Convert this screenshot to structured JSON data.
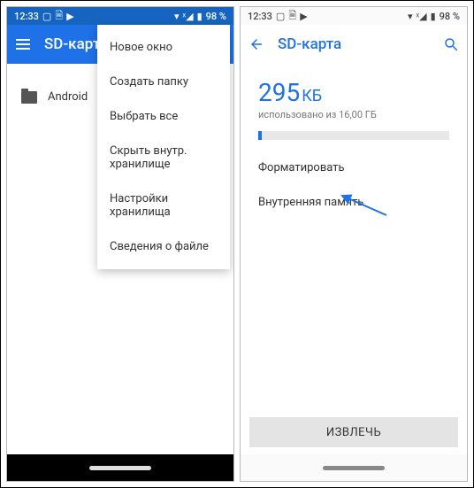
{
  "status": {
    "time": "12:33",
    "battery_pct": "98 %",
    "icons_left": [
      "image-icon",
      "file-icon",
      "play-icon"
    ],
    "icons_right": [
      "wifi-icon",
      "signal-x-icon",
      "battery-icon"
    ]
  },
  "left": {
    "appbar_title": "SD-карта",
    "menu": [
      "Новое окно",
      "Создать папку",
      "Выбрать все",
      "Скрыть внутр. хранилище",
      "Настройки хранилища",
      "Сведения о файле"
    ],
    "folder_name": "Android"
  },
  "right": {
    "appbar_title": "SD-карта",
    "used_value": "295",
    "used_unit": "КБ",
    "used_caption": "использовано из 16,00 ГБ",
    "option_format": "Форматировать",
    "option_internal": "Внутренняя память",
    "eject_label": "ИЗВЛЕЧЬ"
  }
}
